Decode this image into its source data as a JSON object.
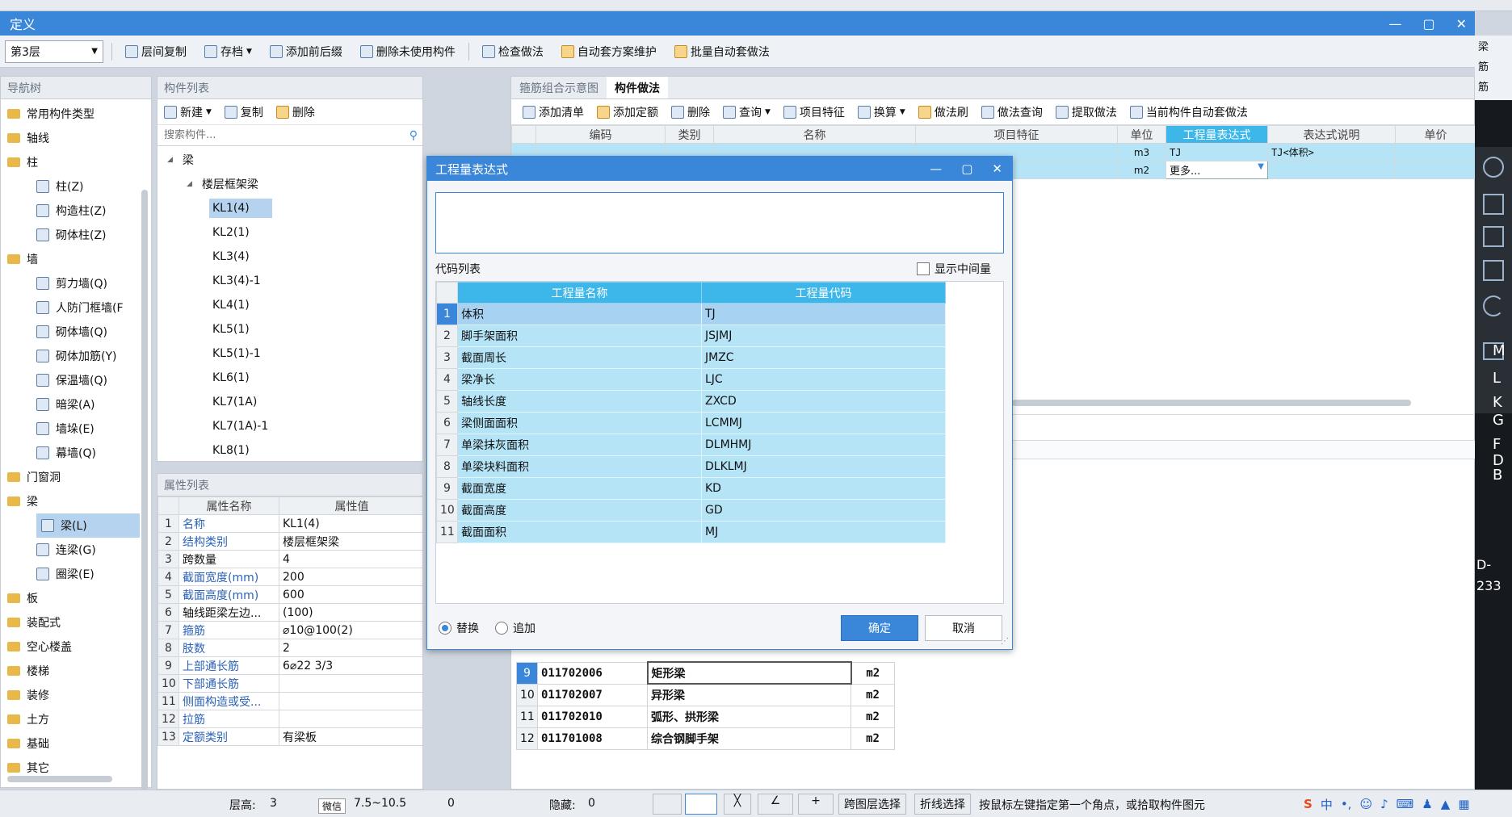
{
  "window": {
    "title": "定义"
  },
  "toolbar": {
    "floor": "第3层",
    "items": [
      "层间复制",
      "存档",
      "添加前后缀",
      "删除未使用构件",
      "检查做法",
      "自动套方案维护",
      "批量自动套做法"
    ]
  },
  "nav": {
    "title": "导航树",
    "items": [
      {
        "label": "常用构件类型",
        "level": 0,
        "type": "folder"
      },
      {
        "label": "轴线",
        "level": 0,
        "type": "folder"
      },
      {
        "label": "柱",
        "level": 0,
        "type": "folder-open"
      },
      {
        "label": "柱(Z)",
        "level": 1,
        "type": "item"
      },
      {
        "label": "构造柱(Z)",
        "level": 1,
        "type": "item"
      },
      {
        "label": "砌体柱(Z)",
        "level": 1,
        "type": "item"
      },
      {
        "label": "墙",
        "level": 0,
        "type": "folder-open"
      },
      {
        "label": "剪力墙(Q)",
        "level": 1,
        "type": "item"
      },
      {
        "label": "人防门框墙(F",
        "level": 1,
        "type": "item"
      },
      {
        "label": "砌体墙(Q)",
        "level": 1,
        "type": "item"
      },
      {
        "label": "砌体加筋(Y)",
        "level": 1,
        "type": "item"
      },
      {
        "label": "保温墙(Q)",
        "level": 1,
        "type": "item"
      },
      {
        "label": "暗梁(A)",
        "level": 1,
        "type": "item"
      },
      {
        "label": "墙垛(E)",
        "level": 1,
        "type": "item"
      },
      {
        "label": "幕墙(Q)",
        "level": 1,
        "type": "item"
      },
      {
        "label": "门窗洞",
        "level": 0,
        "type": "folder"
      },
      {
        "label": "梁",
        "level": 0,
        "type": "folder-open"
      },
      {
        "label": "梁(L)",
        "level": 1,
        "type": "item",
        "selected": true
      },
      {
        "label": "连梁(G)",
        "level": 1,
        "type": "item"
      },
      {
        "label": "圈梁(E)",
        "level": 1,
        "type": "item"
      },
      {
        "label": "板",
        "level": 0,
        "type": "folder"
      },
      {
        "label": "装配式",
        "level": 0,
        "type": "folder"
      },
      {
        "label": "空心楼盖",
        "level": 0,
        "type": "folder"
      },
      {
        "label": "楼梯",
        "level": 0,
        "type": "folder"
      },
      {
        "label": "装修",
        "level": 0,
        "type": "folder"
      },
      {
        "label": "土方",
        "level": 0,
        "type": "folder"
      },
      {
        "label": "基础",
        "level": 0,
        "type": "folder"
      },
      {
        "label": "其它",
        "level": 0,
        "type": "folder"
      }
    ]
  },
  "components": {
    "title": "构件列表",
    "toolbar": [
      "新建",
      "复制",
      "删除"
    ],
    "search_placeholder": "搜索构件...",
    "group": "梁",
    "subgroup": "楼层框架梁",
    "items": [
      "KL1(4)",
      "KL2(1)",
      "KL3(4)",
      "KL3(4)-1",
      "KL4(1)",
      "KL5(1)",
      "KL5(1)-1",
      "KL6(1)",
      "KL7(1A)",
      "KL7(1A)-1",
      "KL8(1)"
    ],
    "selected": "KL1(4)"
  },
  "properties": {
    "title": "属性列表",
    "headers": [
      "属性名称",
      "属性值"
    ],
    "rows": [
      {
        "n": "1",
        "name": "名称",
        "value": "KL1(4)",
        "blue": true,
        "cb": false
      },
      {
        "n": "2",
        "name": "结构类别",
        "value": "楼层框架梁",
        "blue": true,
        "cb": false
      },
      {
        "n": "3",
        "name": "跨数量",
        "value": "4",
        "blue": false,
        "cb": false
      },
      {
        "n": "4",
        "name": "截面宽度(mm)",
        "value": "200",
        "blue": true,
        "cb": false
      },
      {
        "n": "5",
        "name": "截面高度(mm)",
        "value": "600",
        "blue": true,
        "cb": false
      },
      {
        "n": "6",
        "name": "轴线距梁左边...",
        "value": "(100)",
        "blue": false,
        "cb": false
      },
      {
        "n": "7",
        "name": "箍筋",
        "value": "⌀10@100(2)",
        "blue": true,
        "cb": true
      },
      {
        "n": "8",
        "name": "肢数",
        "value": "2",
        "blue": true,
        "cb": false
      },
      {
        "n": "9",
        "name": "上部通长筋",
        "value": "6⌀22 3/3",
        "blue": true,
        "cb": true
      },
      {
        "n": "10",
        "name": "下部通长筋",
        "value": "",
        "blue": true,
        "cb": true
      },
      {
        "n": "11",
        "name": "侧面构造或受...",
        "value": "",
        "blue": true,
        "cb": true
      },
      {
        "n": "12",
        "name": "拉筋",
        "value": "",
        "blue": true,
        "cb": true
      },
      {
        "n": "13",
        "name": "定额类别",
        "value": "有梁板",
        "blue": true,
        "cb": false
      }
    ]
  },
  "method": {
    "tabs": [
      "箍筋组合示意图",
      "构件做法"
    ],
    "toolbar": [
      "添加清单",
      "添加定额",
      "删除",
      "查询",
      "项目特征",
      "换算",
      "做法刷",
      "做法查询",
      "提取做法",
      "当前构件自动套做法"
    ],
    "headers": [
      "编码",
      "类别",
      "名称",
      "项目特征",
      "单位",
      "工程量表达式",
      "表达式说明",
      "单价"
    ],
    "rows": [
      {
        "unit": "m3",
        "expr": "TJ",
        "desc": "TJ<体积>"
      },
      {
        "unit": "m2",
        "expr": "更多...",
        "desc": ""
      }
    ]
  },
  "lower_table": [
    {
      "n": "9",
      "code": "011702006",
      "name": "矩形梁",
      "unit": "m2"
    },
    {
      "n": "10",
      "code": "011702007",
      "name": "异形梁",
      "unit": "m2"
    },
    {
      "n": "11",
      "code": "011702010",
      "name": "弧形、拱形梁",
      "unit": "m2"
    },
    {
      "n": "12",
      "code": "011701008",
      "name": "综合钢脚手架",
      "unit": "m2"
    }
  ],
  "dialog": {
    "title": "工程量表达式",
    "code_list_label": "代码列表",
    "show_intermediate": "显示中间量",
    "headers": [
      "工程量名称",
      "工程量代码"
    ],
    "rows": [
      {
        "n": "1",
        "name": "体积",
        "code": "TJ"
      },
      {
        "n": "2",
        "name": "脚手架面积",
        "code": "JSJMJ"
      },
      {
        "n": "3",
        "name": "截面周长",
        "code": "JMZC"
      },
      {
        "n": "4",
        "name": "梁净长",
        "code": "LJC"
      },
      {
        "n": "5",
        "name": "轴线长度",
        "code": "ZXCD"
      },
      {
        "n": "6",
        "name": "梁侧面面积",
        "code": "LCMMJ"
      },
      {
        "n": "7",
        "name": "单梁抹灰面积",
        "code": "DLMHMJ"
      },
      {
        "n": "8",
        "name": "单梁块料面积",
        "code": "DLKLMJ"
      },
      {
        "n": "9",
        "name": "截面宽度",
        "code": "KD"
      },
      {
        "n": "10",
        "name": "截面高度",
        "code": "GD"
      },
      {
        "n": "11",
        "name": "截面面积",
        "code": "MJ"
      }
    ],
    "radio_replace": "替换",
    "radio_append": "追加",
    "ok": "确定",
    "cancel": "取消"
  },
  "statusbar": {
    "floor_height_label": "层高:",
    "floor_height": "3",
    "elev": "7.5~10.5",
    "zero": "0",
    "hidden_label": "隐藏:",
    "hidden": "0",
    "btn_span": "跨图层选择",
    "btn_fold": "折线选择",
    "hint": "按鼠标左键指定第一个角点，或拾取构件图元",
    "tooltip": "微信"
  },
  "right_labels": [
    "梁",
    "筋",
    "筋",
    "M",
    "L",
    "K",
    "G",
    "F",
    "D",
    "B",
    "D-",
    "233"
  ]
}
